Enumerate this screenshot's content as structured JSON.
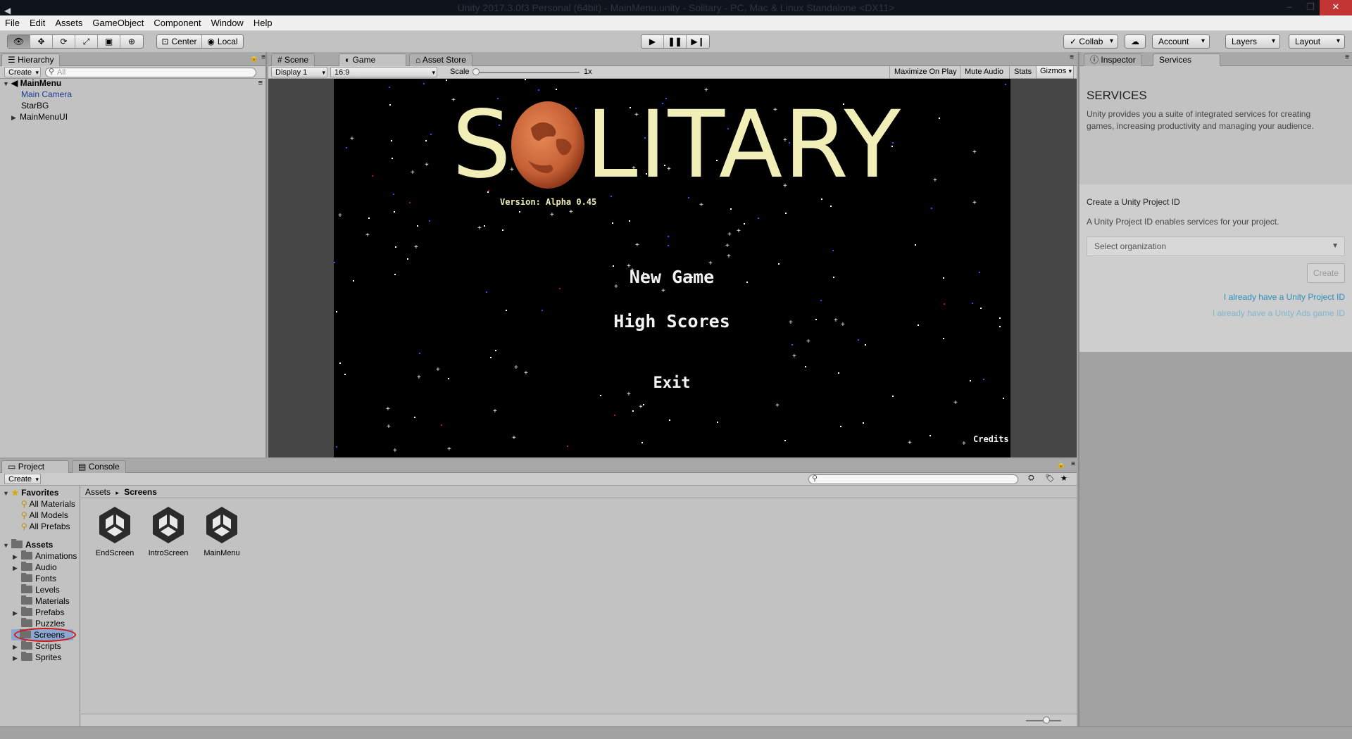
{
  "window": {
    "title": "Unity 2017.3.0f3 Personal (64bit) - MainMenu.unity - Solitary - PC, Mac & Linux Standalone <DX11>",
    "close_label": "✕",
    "min_label": "–",
    "max_label": "❐"
  },
  "menubar": [
    "File",
    "Edit",
    "Assets",
    "GameObject",
    "Component",
    "Window",
    "Help"
  ],
  "toolbar": {
    "pivot": "Center",
    "space": "Local",
    "collab": "Collab",
    "account": "Account",
    "layers": "Layers",
    "layout": "Layout"
  },
  "hierarchy": {
    "tab": "Hierarchy",
    "create": "Create",
    "search_placeholder": "All",
    "scene": "MainMenu",
    "items": [
      "Main Camera",
      "StarBG",
      "MainMenuUI"
    ]
  },
  "center_tabs": [
    "Scene",
    "Game",
    "Asset Store"
  ],
  "game_bar": {
    "display": "Display 1",
    "aspect": "16:9",
    "scale_label": "Scale",
    "scale_value": "1x",
    "maximize": "Maximize On Play",
    "mute": "Mute Audio",
    "stats": "Stats",
    "gizmos": "Gizmos"
  },
  "game": {
    "title_left": "S",
    "title_right": "LITARY",
    "version": "Version: Alpha 0.45",
    "new_game": "New Game",
    "high_scores": "High Scores",
    "exit": "Exit",
    "credits": "Credits"
  },
  "right_tabs": [
    "Inspector",
    "Services"
  ],
  "services": {
    "heading": "SERVICES",
    "description": "Unity provides you a suite of integrated services for creating games, increasing productivity and managing your audience.",
    "create_id_title": "Create a Unity Project ID",
    "create_id_text": "A Unity Project ID enables services for your project.",
    "org_placeholder": "Select organization",
    "create_button": "Create",
    "link1": "I already have a Unity Project ID",
    "link2": "I already have a Unity Ads game ID"
  },
  "bottom_tabs": [
    "Project",
    "Console"
  ],
  "project": {
    "create": "Create",
    "favorites_label": "Favorites",
    "favorites": [
      "All Materials",
      "All Models",
      "All Prefabs"
    ],
    "assets_label": "Assets",
    "folders": [
      "Animations",
      "Audio",
      "Fonts",
      "Levels",
      "Materials",
      "Prefabs",
      "Puzzles",
      "Screens",
      "Scripts",
      "Sprites"
    ],
    "breadcrumb_root": "Assets",
    "breadcrumb_current": "Screens",
    "files": [
      "EndScreen",
      "IntroScreen",
      "MainMenu"
    ]
  }
}
